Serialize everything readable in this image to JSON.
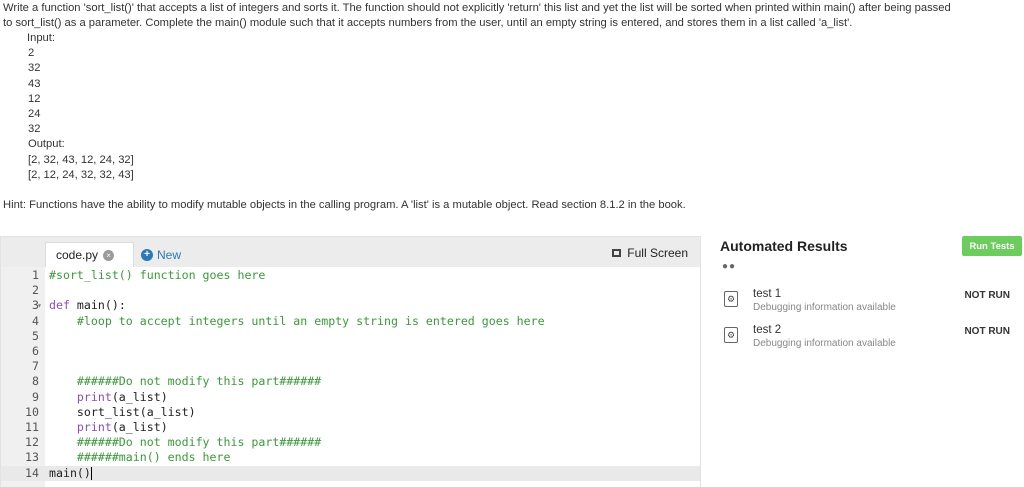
{
  "prompt": {
    "line1": "Write a function 'sort_list()' that accepts a list of integers and sorts it. The function should not explicitly 'return' this list and yet the list will be sorted when printed within main() after being passed",
    "line2": "to sort_list() as a parameter. Complete the main() module such that it accepts numbers from the user, until an empty string is entered, and stores them in a list called 'a_list'.",
    "input_label": "Input:",
    "input_values": [
      "2",
      "32",
      "43",
      "12",
      "24",
      "32"
    ],
    "output_label": "Output:",
    "output_values": [
      "[2, 32, 43, 12, 24, 32]",
      "[2, 12, 24, 32, 32, 43]"
    ],
    "hint": "Hint: Functions have the ability to modify mutable objects in the calling program. A 'list' is a mutable object. Read section 8.1.2 in the book."
  },
  "editor": {
    "tab_label": "code.py",
    "close_glyph": "×",
    "new_label": "New",
    "new_glyph": "+",
    "fullscreen_label": "Full Screen",
    "lines": [
      {
        "n": "1",
        "text": "#sort_list() function goes here"
      },
      {
        "n": "2",
        "text": ""
      },
      {
        "n": "3",
        "kw": "def",
        "text": " main():"
      },
      {
        "n": "4",
        "text": "    #loop to accept integers until an empty string is entered goes here"
      },
      {
        "n": "5",
        "text": ""
      },
      {
        "n": "6",
        "text": ""
      },
      {
        "n": "7",
        "text": ""
      },
      {
        "n": "8",
        "text": "    ######Do not modify this part######"
      },
      {
        "n": "9",
        "kw": "    print",
        "text": "(a_list)"
      },
      {
        "n": "10",
        "text": "    sort_list(a_list)"
      },
      {
        "n": "11",
        "kw": "    print",
        "text": "(a_list)"
      },
      {
        "n": "12",
        "text": "    ######Do not modify this part######"
      },
      {
        "n": "13",
        "text": "    ######main() ends here"
      },
      {
        "n": "14",
        "text": "main()"
      }
    ]
  },
  "results": {
    "title": "Automated Results",
    "run_label": "Run Tests",
    "dots": "●●",
    "tests": [
      {
        "name": "test 1",
        "debug": "Debugging information available",
        "status": "NOT RUN"
      },
      {
        "name": "test 2",
        "debug": "Debugging information available",
        "status": "NOT RUN"
      }
    ]
  }
}
